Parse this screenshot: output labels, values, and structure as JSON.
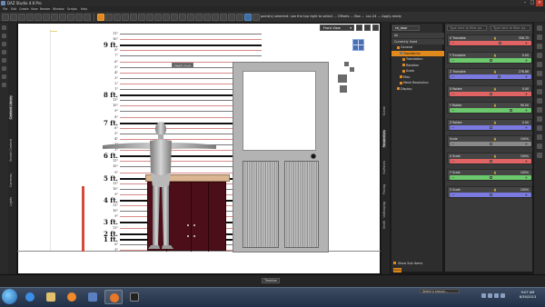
{
  "window": {
    "title": "DAZ Studio 4.6 Pro"
  },
  "menu": [
    "File",
    "Edit",
    "Create",
    "View",
    "Render",
    "Window",
    "Scripts",
    "Help"
  ],
  "toolbar": {
    "message": "point(s) selected: use the top right to select ... Offsets ... Box ... Loc-24 ... Apply-ready"
  },
  "left_tabs": [
    {
      "label": "Content Library",
      "selected": true
    },
    {
      "label": "Smart Content",
      "selected": false
    },
    {
      "label": "Cameras",
      "selected": false
    },
    {
      "label": "Lights",
      "selected": false
    }
  ],
  "viewport": {
    "view_select": "Front View",
    "tooltip": "Height Chart"
  },
  "height_chart": {
    "labels": [
      "11\"",
      "10\"",
      "9 ft.",
      "8\"",
      "7\"",
      "6\"",
      "5\"",
      "4\"",
      "3\"",
      "2\"",
      "1\"",
      "8 ft.",
      "11\"",
      "10\"",
      "9\"",
      "8\"",
      "7 ft.",
      "6\"",
      "5\"",
      "4\"",
      "3\"",
      "2\"",
      "6 ft.",
      "11\"",
      "10\"",
      "9\"",
      "5 ft.",
      "11\"",
      "10\"",
      "9\"",
      "4 ft.",
      "11\"",
      "10\"",
      "9\"",
      "3 ft.",
      "11\"",
      "2 ft.",
      "1 ft.",
      "6\"",
      "3\""
    ]
  },
  "right_tabs": [
    {
      "label": "Scene",
      "selected": false
    },
    {
      "label": "Parameters",
      "selected": true
    },
    {
      "label": "Surfaces",
      "selected": false
    },
    {
      "label": "Posing",
      "selected": false
    },
    {
      "label": "Shaping",
      "selected": false
    },
    {
      "label": "Uv",
      "selected": false
    },
    {
      "label": "Dedit",
      "selected": false
    }
  ],
  "scene_panel": {
    "search_value": "ce_door",
    "rows": [
      {
        "label": "All",
        "indent": 0,
        "state": "dark"
      },
      {
        "label": "Currently Used",
        "indent": 0,
        "state": "dark"
      },
      {
        "label": "General",
        "indent": 1,
        "state": "normal"
      },
      {
        "label": "Transforms",
        "indent": 2,
        "state": "selected"
      },
      {
        "label": "Translation",
        "indent": 3,
        "state": "normal"
      },
      {
        "label": "Rotation",
        "indent": 3,
        "state": "normal"
      },
      {
        "label": "Scale",
        "indent": 3,
        "state": "normal"
      },
      {
        "label": "Misc",
        "indent": 2,
        "state": "normal"
      },
      {
        "label": "Mesh Resolution",
        "indent": 2,
        "state": "normal"
      },
      {
        "label": "Display",
        "indent": 1,
        "state": "normal"
      }
    ],
    "show_sub_items": "Show Sub Items",
    "footer_button": "Apply"
  },
  "parameters": {
    "search_placeholder": "Type here to filter pa...",
    "search2_placeholder": "Type here to filter pa...",
    "items": [
      {
        "label": "X Translate",
        "value": "358.75",
        "color": "#e06464",
        "knob": 0.62
      },
      {
        "label": "Y Translate",
        "value": "0.00",
        "color": "#6cc86c",
        "knob": 0.5
      },
      {
        "label": "Z Translate",
        "value": "276.86",
        "color": "#7a7ae0",
        "knob": 0.6
      },
      {
        "label": "X Rotate",
        "value": "0.00",
        "color": "#e06464",
        "knob": 0.5
      },
      {
        "label": "Y Rotate",
        "value": "90.00",
        "color": "#6cc86c",
        "knob": 0.75
      },
      {
        "label": "Z Rotate",
        "value": "0.00",
        "color": "#7a7ae0",
        "knob": 0.5
      },
      {
        "label": "Scale",
        "value": "100%",
        "color": "#8a8a8a",
        "knob": 0.5
      },
      {
        "label": "X Scale",
        "value": "100%",
        "color": "#e06464",
        "knob": 0.5
      },
      {
        "label": "Y Scale",
        "value": "100%",
        "color": "#6cc86c",
        "knob": 0.5
      },
      {
        "label": "Z Scale",
        "value": "100%",
        "color": "#7a7ae0",
        "knob": 0.5
      }
    ]
  },
  "bottom": {
    "timeline": "Timeline",
    "lesson": "Select a Lesson..."
  },
  "taskbar": {
    "time": "9:07 AM",
    "date": "8/30/2013"
  }
}
